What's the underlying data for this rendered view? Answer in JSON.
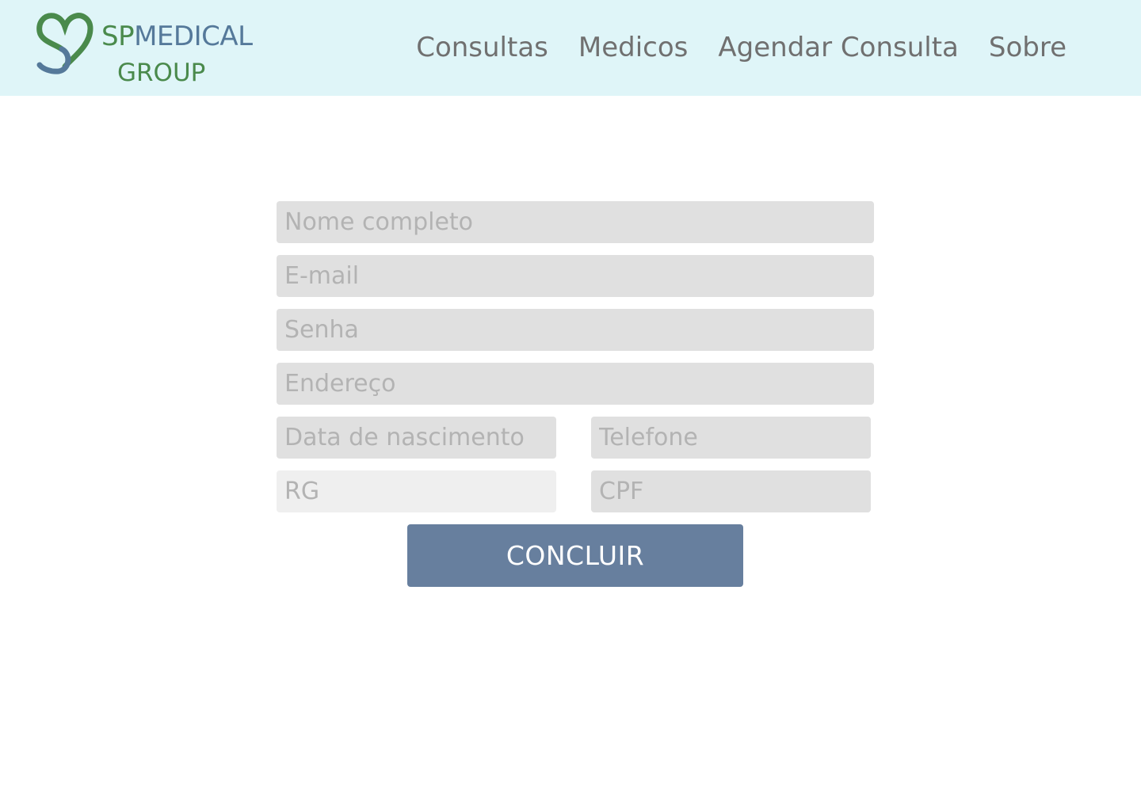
{
  "brand": {
    "logo_sp": "SP",
    "logo_medical": "MEDICAL",
    "logo_group": "GROUP",
    "colors": {
      "green": "#4a8a4c",
      "blue": "#55799a"
    }
  },
  "nav": {
    "items": [
      {
        "label": "Consultas"
      },
      {
        "label": "Medicos"
      },
      {
        "label": "Agendar Consulta"
      },
      {
        "label": "Sobre"
      }
    ]
  },
  "form": {
    "nome": {
      "placeholder": "Nome completo",
      "value": ""
    },
    "email": {
      "placeholder": "E-mail",
      "value": ""
    },
    "senha": {
      "placeholder": "Senha",
      "value": ""
    },
    "endereco": {
      "placeholder": "Endereço",
      "value": ""
    },
    "nascimento": {
      "placeholder": "Data de nascimento",
      "value": ""
    },
    "telefone": {
      "placeholder": "Telefone",
      "value": ""
    },
    "rg": {
      "placeholder": "RG",
      "value": ""
    },
    "cpf": {
      "placeholder": "CPF",
      "value": ""
    },
    "submit_label": "CONCLUIR"
  },
  "theme": {
    "header_bg": "#dff5f8",
    "field_bg": "#e0e0e0",
    "button_bg": "#677f9e",
    "nav_text": "#707070"
  }
}
